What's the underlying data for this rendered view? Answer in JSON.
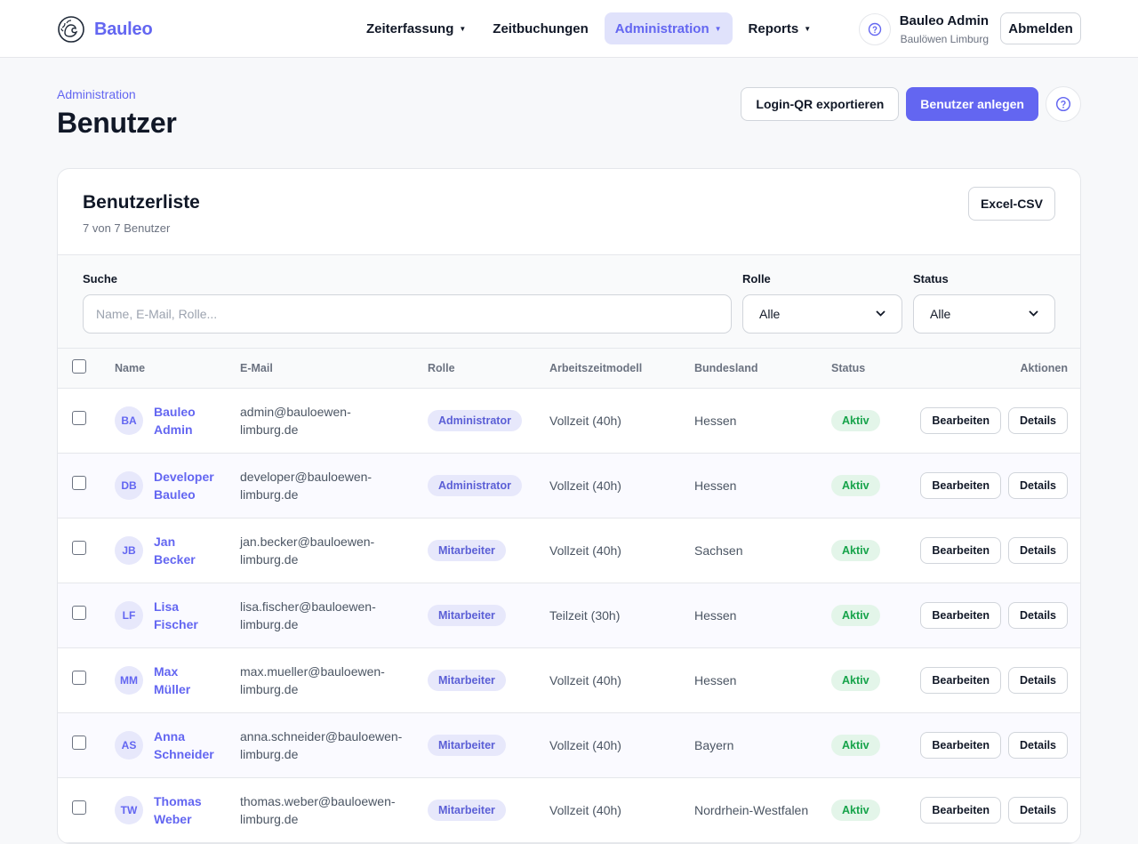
{
  "header": {
    "brand": "Bauleo",
    "nav": [
      {
        "label": "Zeiterfassung",
        "caret": true,
        "active": false
      },
      {
        "label": "Zeitbuchungen",
        "caret": false,
        "active": false
      },
      {
        "label": "Administration",
        "caret": true,
        "active": true
      },
      {
        "label": "Reports",
        "caret": true,
        "active": false
      }
    ],
    "user_name": "Bauleo Admin",
    "user_org": "Baulöwen Limburg",
    "logout_label": "Abmelden"
  },
  "page": {
    "breadcrumb": "Administration",
    "title": "Benutzer",
    "export_qr_label": "Login-QR exportieren",
    "create_user_label": "Benutzer anlegen"
  },
  "card": {
    "title": "Benutzerliste",
    "subtitle": "7 von 7 Benutzer",
    "csv_label": "Excel-CSV"
  },
  "filters": {
    "search_label": "Suche",
    "search_placeholder": "Name, E-Mail, Rolle...",
    "role_label": "Rolle",
    "role_value": "Alle",
    "status_label": "Status",
    "status_value": "Alle"
  },
  "table": {
    "columns": [
      "Name",
      "E-Mail",
      "Rolle",
      "Arbeitszeitmodell",
      "Bundesland",
      "Status",
      "Aktionen"
    ],
    "edit_label": "Bearbeiten",
    "details_label": "Details",
    "rows": [
      {
        "initials": "BA",
        "first": "Bauleo",
        "last": "Admin",
        "email1": "admin@bauloewen-",
        "email2": "limburg.de",
        "role": "Administrator",
        "model": "Vollzeit (40h)",
        "state": "Hessen",
        "status": "Aktiv"
      },
      {
        "initials": "DB",
        "first": "Developer",
        "last": "Bauleo",
        "email1": "developer@bauloewen-",
        "email2": "limburg.de",
        "role": "Administrator",
        "model": "Vollzeit (40h)",
        "state": "Hessen",
        "status": "Aktiv"
      },
      {
        "initials": "JB",
        "first": "Jan",
        "last": "Becker",
        "email1": "jan.becker@bauloewen-",
        "email2": "limburg.de",
        "role": "Mitarbeiter",
        "model": "Vollzeit (40h)",
        "state": "Sachsen",
        "status": "Aktiv"
      },
      {
        "initials": "LF",
        "first": "Lisa",
        "last": "Fischer",
        "email1": "lisa.fischer@bauloewen-",
        "email2": "limburg.de",
        "role": "Mitarbeiter",
        "model": "Teilzeit (30h)",
        "state": "Hessen",
        "status": "Aktiv"
      },
      {
        "initials": "MM",
        "first": "Max",
        "last": "Müller",
        "email1": "max.mueller@bauloewen-",
        "email2": "limburg.de",
        "role": "Mitarbeiter",
        "model": "Vollzeit (40h)",
        "state": "Hessen",
        "status": "Aktiv"
      },
      {
        "initials": "AS",
        "first": "Anna",
        "last": "Schneider",
        "email1": "anna.schneider@bauloewen-",
        "email2": "limburg.de",
        "role": "Mitarbeiter",
        "model": "Vollzeit (40h)",
        "state": "Bayern",
        "status": "Aktiv"
      },
      {
        "initials": "TW",
        "first": "Thomas",
        "last": "Weber",
        "email1": "thomas.weber@bauloewen-",
        "email2": "limburg.de",
        "role": "Mitarbeiter",
        "model": "Vollzeit (40h)",
        "state": "Nordrhein-Westfalen",
        "status": "Aktiv"
      }
    ]
  }
}
